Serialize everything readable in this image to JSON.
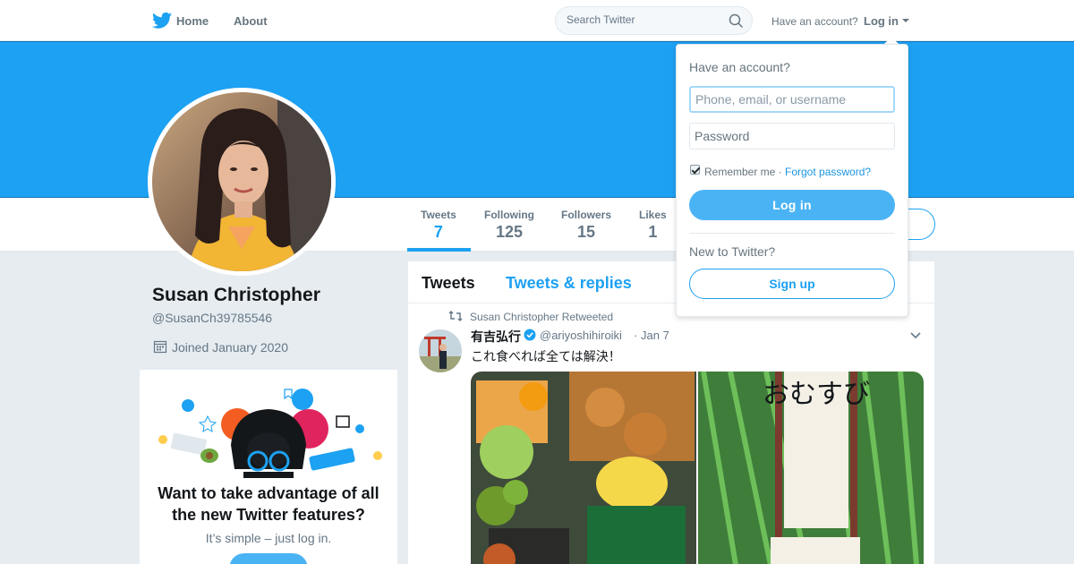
{
  "nav": {
    "home_label": "Home",
    "about_label": "About",
    "search_placeholder": "Search Twitter",
    "have_account": "Have an account?",
    "login_label": "Log in"
  },
  "profile": {
    "name": "Susan Christopher",
    "handle": "@SusanCh39785546",
    "joined": "Joined January 2020"
  },
  "stats": [
    {
      "label": "Tweets",
      "value": "7"
    },
    {
      "label": "Following",
      "value": "125"
    },
    {
      "label": "Followers",
      "value": "15"
    },
    {
      "label": "Likes",
      "value": "1"
    }
  ],
  "promo": {
    "title": "Want to take advantage of all the new Twitter features?",
    "subtitle": "It’s simple – just log in."
  },
  "timeline": {
    "tab_tweets": "Tweets",
    "tab_replies": "Tweets & replies",
    "tweet": {
      "retweeted_by": "Susan Christopher Retweeted",
      "author_name": "有吉弘行",
      "author_handle": "@ariyoshihiroiki",
      "separator": "·",
      "date": "Jan 7",
      "text": "これ食べれば全ては解決！",
      "media_caption": "おむすび"
    }
  },
  "login_dropdown": {
    "title": "Have an account?",
    "username_placeholder": "Phone, email, or username",
    "password_placeholder": "Password",
    "remember_me": "Remember me",
    "separator": "·",
    "forgot_password": "Forgot password?",
    "login_button": "Log in",
    "new_to_twitter": "New to Twitter?",
    "signup_button": "Sign up"
  },
  "colors": {
    "brand_blue": "#1da1f2",
    "button_blue": "#4ab3f4"
  }
}
